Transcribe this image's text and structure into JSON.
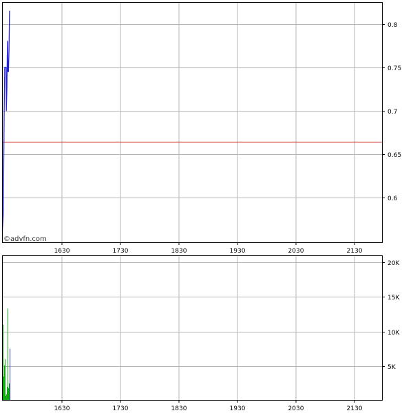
{
  "watermark": "©advfn.com",
  "colors": {
    "price_line": "#2222dd",
    "reference_line": "#cc2222",
    "volume_bars": "#11aa11",
    "volume_bar_alt": "#2233cc",
    "grid": "#b4b4b4",
    "frame": "#000000"
  },
  "chart_data": [
    {
      "type": "line",
      "x_tick_labels": [
        "1630",
        "1730",
        "1830",
        "1930",
        "2030",
        "2130"
      ],
      "y_tick_labels": [
        "0.8",
        "0.75",
        "0.7",
        "0.65",
        "0.6"
      ],
      "xlim": [
        1530,
        2240
      ],
      "ylim": [
        0.548,
        0.825
      ],
      "y_axis_side": "right",
      "grid": true,
      "reference_line": {
        "y": 0.664
      },
      "series": [
        {
          "x": [
            1530.5,
            1532,
            1533,
            1534,
            1535,
            1536,
            1537,
            1537.5,
            1538,
            1539,
            1540,
            1541,
            1542,
            1543,
            1544
          ],
          "values": [
            0.562,
            0.58,
            0.625,
            0.7,
            0.75,
            0.75,
            0.75,
            0.75,
            0.7,
            0.725,
            0.78,
            0.745,
            0.745,
            0.77,
            0.815
          ]
        }
      ]
    },
    {
      "type": "bar",
      "x_tick_labels": [
        "1630",
        "1730",
        "1830",
        "1930",
        "2030",
        "2130"
      ],
      "y_tick_labels": [
        "20K",
        "15K",
        "10K",
        "5K"
      ],
      "xlim": [
        1530,
        2240
      ],
      "ylim": [
        0,
        21000
      ],
      "y_axis_side": "right",
      "grid": true,
      "series": [
        {
          "x": [
            1530.5,
            1531.5,
            1532.5,
            1533.5,
            1534.5,
            1535.5,
            1536.5,
            1537.5,
            1538.5,
            1539.5,
            1540.5,
            1541.5,
            1542.5,
            1543.5
          ],
          "values": [
            19400,
            11000,
            3500,
            5100,
            2800,
            6000,
            700,
            900,
            2000,
            500,
            13300,
            1800,
            2500,
            7500
          ]
        }
      ]
    }
  ]
}
